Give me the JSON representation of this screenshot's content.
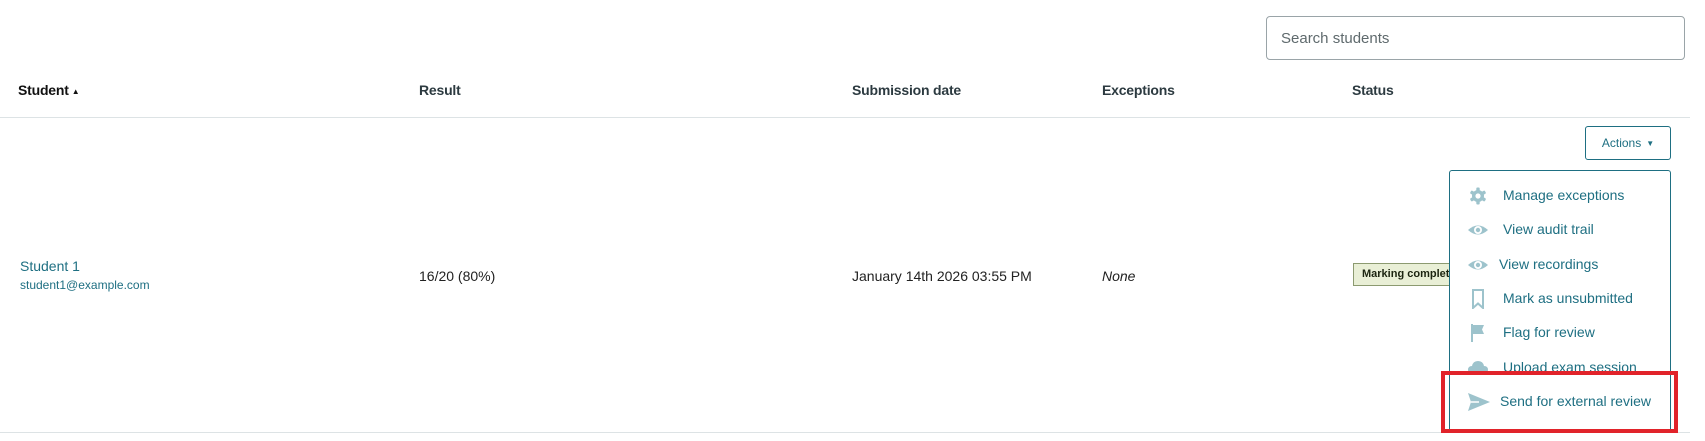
{
  "search": {
    "placeholder": "Search students",
    "value": ""
  },
  "table": {
    "headers": {
      "student": "Student",
      "student_sort_indicator": "▲",
      "result": "Result",
      "submission_date": "Submission date",
      "exceptions": "Exceptions",
      "status": "Status"
    },
    "rows": [
      {
        "student_name": "Student 1",
        "student_email": "student1@example.com",
        "result": "16/20 (80%)",
        "submission_date": "January 14th 2026 03:55 PM",
        "exceptions": "None",
        "status": "Marking complete"
      }
    ]
  },
  "actions": {
    "button_label": "Actions",
    "caret": "▼",
    "menu": [
      {
        "label": "Manage exceptions",
        "icon": "gear-icon"
      },
      {
        "label": "View audit trail",
        "icon": "eye-icon"
      },
      {
        "label": "View recordings",
        "icon": "eye-icon"
      },
      {
        "label": "Mark as unsubmitted",
        "icon": "bookmark-icon"
      },
      {
        "label": "Flag for review",
        "icon": "flag-icon"
      },
      {
        "label": "Upload exam session",
        "icon": "cloud-upload-icon"
      },
      {
        "label": "Send for external review",
        "icon": "send-icon"
      }
    ]
  },
  "colors": {
    "link": "#1e6f82",
    "icon": "#9dc3cc",
    "status_badge_bg": "#e9efd6",
    "highlight": "#e1232a"
  }
}
